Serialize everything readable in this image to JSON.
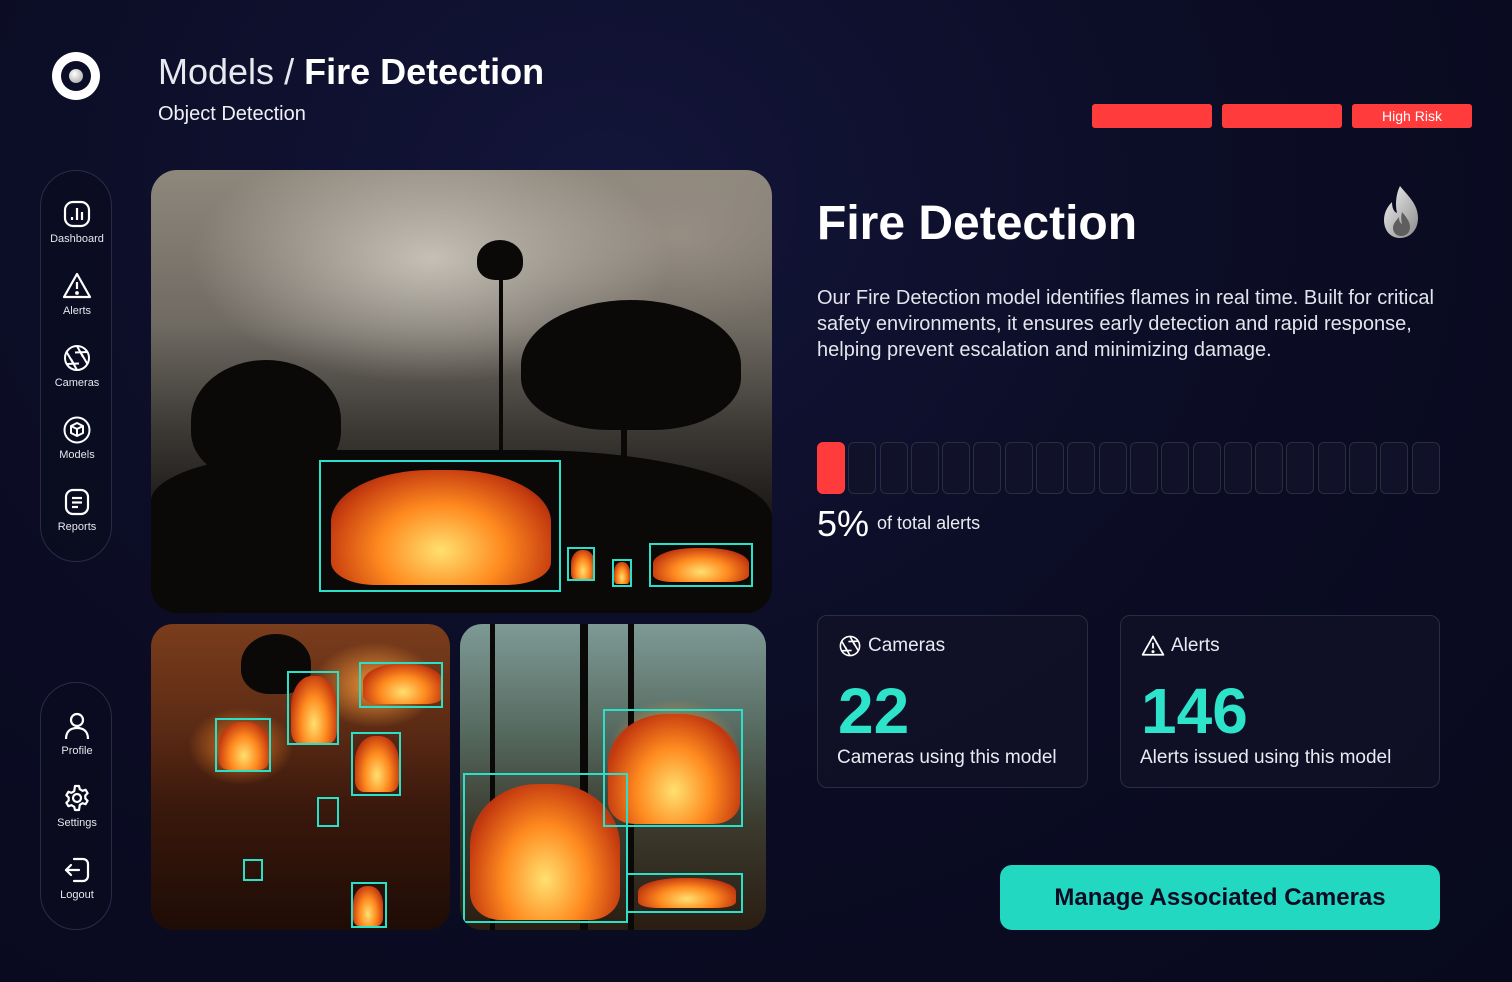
{
  "header": {
    "breadcrumb_parent": "Models",
    "breadcrumb_separator": "/",
    "breadcrumb_current": "Fire Detection",
    "subtitle": "Object Detection"
  },
  "tags": [
    {
      "label": "",
      "color": "#ff3b3b"
    },
    {
      "label": "",
      "color": "#ff3b3b"
    },
    {
      "label": "High Risk",
      "color": "#ff3b3b"
    }
  ],
  "sidebar": {
    "items": [
      {
        "label": "Dashboard",
        "icon": "dashboard-icon"
      },
      {
        "label": "Alerts",
        "icon": "warning-icon"
      },
      {
        "label": "Cameras",
        "icon": "aperture-icon"
      },
      {
        "label": "Models",
        "icon": "cube-icon"
      },
      {
        "label": "Reports",
        "icon": "document-icon"
      }
    ],
    "bottom_items": [
      {
        "label": "Profile",
        "icon": "user-icon"
      },
      {
        "label": "Settings",
        "icon": "gear-icon"
      },
      {
        "label": "Logout",
        "icon": "logout-icon"
      }
    ]
  },
  "detail": {
    "title": "Fire Detection",
    "icon": "fire-icon",
    "description": "Our Fire Detection model identifies flames in real time. Built for critical safety environments, it ensures early detection and rapid response, helping prevent escalation and minimizing damage."
  },
  "alert_share": {
    "percent_text": "5%",
    "fraction": 0.05,
    "label": "of total alerts",
    "segments": 20
  },
  "stats": {
    "cameras": {
      "title": "Cameras",
      "value": "22",
      "caption": "Cameras using this model",
      "icon": "aperture-icon"
    },
    "alerts": {
      "title": "Alerts",
      "value": "146",
      "caption": "Alerts issued using this model",
      "icon": "warning-icon"
    }
  },
  "cta": {
    "label": "Manage Associated Cameras"
  },
  "colors": {
    "accent": "#22d8c0",
    "danger": "#ff3b3b",
    "bbox": "#2be0c9",
    "background": "#0c0d26"
  }
}
